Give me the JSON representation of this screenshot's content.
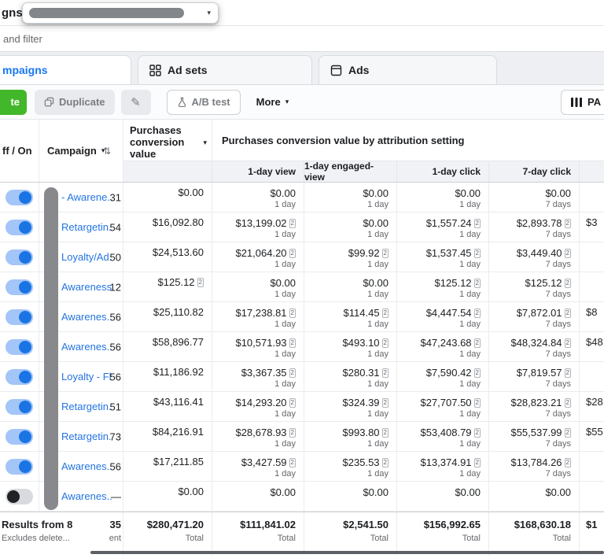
{
  "chrome": {
    "clipped_title": "gns",
    "filter_text": "and filter",
    "tabs": {
      "campaigns": "mpaigns",
      "ad_sets": "Ad sets",
      "ads": "Ads"
    },
    "toolbar": {
      "create": "te",
      "duplicate": "Duplicate",
      "ab_test": "A/B test",
      "more": "More",
      "columns": "PA"
    }
  },
  "icons": {
    "chevron_down": "▾",
    "sort_arrows": "⇅",
    "pencil": "✎"
  },
  "table": {
    "footnote_marker": "2",
    "header": {
      "toggle": "ff / On",
      "campaign": "Campaign",
      "purchases": "Purchases conversion value",
      "attribution_group": "Purchases conversion value by attribution setting",
      "subs": [
        "1-day view",
        "1-day engaged-view",
        "1-day click",
        "7-day click"
      ]
    },
    "rows": [
      {
        "on": true,
        "name": "- Awarene...",
        "clip": "31",
        "purchases": "$0.00",
        "cells": [
          {
            "v": "$0.00",
            "s": "1 day"
          },
          {
            "v": "$0.00",
            "s": "1 day"
          },
          {
            "v": "$0.00",
            "s": "1 day"
          },
          {
            "v": "$0.00",
            "s": "7 days"
          }
        ],
        "frag": ""
      },
      {
        "on": true,
        "name": "Retargetin...",
        "clip": "54",
        "purchases": "$16,092.80",
        "cells": [
          {
            "v": "$13,199.02",
            "n": true,
            "s": "1 day"
          },
          {
            "v": "$0.00",
            "s": "1 day"
          },
          {
            "v": "$1,557.24",
            "n": true,
            "s": "1 day"
          },
          {
            "v": "$2,893.78",
            "n": true,
            "s": "7 days"
          }
        ],
        "frag": "$3"
      },
      {
        "on": true,
        "name": "Loyalty/Ad...",
        "clip": "50",
        "purchases": "$24,513.60",
        "cells": [
          {
            "v": "$21,064.20",
            "n": true,
            "s": "1 day"
          },
          {
            "v": "$99.92",
            "n": true,
            "s": "1 day"
          },
          {
            "v": "$1,537.45",
            "n": true,
            "s": "1 day"
          },
          {
            "v": "$3,449.40",
            "n": true,
            "s": "7 days"
          }
        ],
        "frag": ""
      },
      {
        "on": true,
        "name": "Awareness...",
        "clip": "12",
        "purchases": "$125.12",
        "pn": true,
        "cells": [
          {
            "v": "$0.00",
            "s": "1 day"
          },
          {
            "v": "$0.00",
            "s": "1 day"
          },
          {
            "v": "$125.12",
            "n": true,
            "s": "1 day"
          },
          {
            "v": "$125.12",
            "n": true,
            "s": "7 days"
          }
        ],
        "frag": ""
      },
      {
        "on": true,
        "name": "Awarenes...",
        "clip": "56",
        "purchases": "$25,110.82",
        "cells": [
          {
            "v": "$17,238.81",
            "n": true,
            "s": "1 day"
          },
          {
            "v": "$114.45",
            "n": true,
            "s": "1 day"
          },
          {
            "v": "$4,447.54",
            "n": true,
            "s": "1 day"
          },
          {
            "v": "$7,872.01",
            "n": true,
            "s": "7 days"
          }
        ],
        "frag": "$8"
      },
      {
        "on": true,
        "name": "Awarenes...",
        "clip": "56",
        "purchases": "$58,896.77",
        "cells": [
          {
            "v": "$10,571.93",
            "n": true,
            "s": "1 day"
          },
          {
            "v": "$493.10",
            "n": true,
            "s": "1 day"
          },
          {
            "v": "$47,243.68",
            "n": true,
            "s": "1 day"
          },
          {
            "v": "$48,324.84",
            "n": true,
            "s": "7 days"
          }
        ],
        "frag": "$48"
      },
      {
        "on": true,
        "name": "Loyalty - Fl...",
        "clip": "56",
        "purchases": "$11,186.92",
        "cells": [
          {
            "v": "$3,367.35",
            "n": true,
            "s": "1 day"
          },
          {
            "v": "$280.31",
            "n": true,
            "s": "1 day"
          },
          {
            "v": "$7,590.42",
            "n": true,
            "s": "1 day"
          },
          {
            "v": "$7,819.57",
            "n": true,
            "s": "7 days"
          }
        ],
        "frag": ""
      },
      {
        "on": true,
        "name": "Retargetin...",
        "clip": "51",
        "purchases": "$43,116.41",
        "cells": [
          {
            "v": "$14,293.20",
            "n": true,
            "s": "1 day"
          },
          {
            "v": "$324.39",
            "n": true,
            "s": "1 day"
          },
          {
            "v": "$27,707.50",
            "n": true,
            "s": "1 day"
          },
          {
            "v": "$28,823.21",
            "n": true,
            "s": "7 days"
          }
        ],
        "frag": "$28"
      },
      {
        "on": true,
        "name": "Retargetin...",
        "clip": "73",
        "purchases": "$84,216.91",
        "cells": [
          {
            "v": "$28,678.93",
            "n": true,
            "s": "1 day"
          },
          {
            "v": "$993.80",
            "n": true,
            "s": "1 day"
          },
          {
            "v": "$53,408.79",
            "n": true,
            "s": "1 day"
          },
          {
            "v": "$55,537.99",
            "n": true,
            "s": "7 days"
          }
        ],
        "frag": "$55"
      },
      {
        "on": true,
        "name": "Awarenes...",
        "clip": "56",
        "purchases": "$17,211.85",
        "cells": [
          {
            "v": "$3,427.59",
            "n": true,
            "s": "1 day"
          },
          {
            "v": "$235.53",
            "n": true,
            "s": "1 day"
          },
          {
            "v": "$13,374.91",
            "n": true,
            "s": "1 day"
          },
          {
            "v": "$13,784.26",
            "n": true,
            "s": "7 days"
          }
        ],
        "frag": ""
      },
      {
        "on": false,
        "name": "Awarenes...",
        "clip": "—",
        "purchases": "$0.00",
        "cells": [
          {
            "v": "$0.00"
          },
          {
            "v": "$0.00"
          },
          {
            "v": "$0.00"
          },
          {
            "v": "$0.00"
          }
        ],
        "frag": ""
      }
    ],
    "totals": {
      "label": "Results from 8",
      "note": "Excludes delete...",
      "clip": "35",
      "clip_note": "ent",
      "purchases": "$280,471.20",
      "cells": [
        "$111,841.02",
        "$2,541.50",
        "$156,992.65",
        "$168,630.18"
      ],
      "frag": "$1",
      "total_word": "Total"
    }
  }
}
